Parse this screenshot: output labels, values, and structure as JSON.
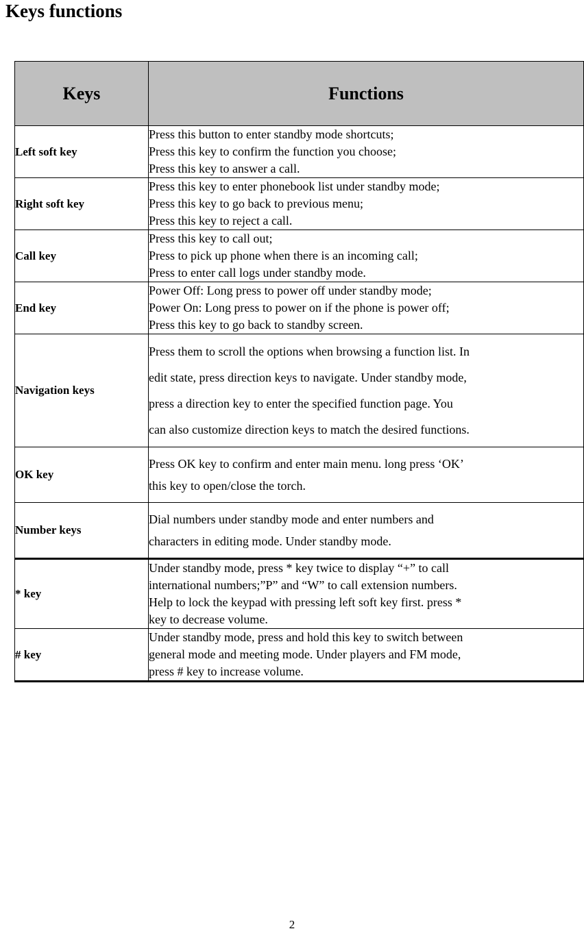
{
  "document": {
    "title": "Keys functions",
    "page_number": "2",
    "header_fill_color": "#BFBFBF",
    "text_color": "#000000",
    "border_color": "#000000"
  },
  "table": {
    "columns": [
      {
        "header": "Keys",
        "align": "center"
      },
      {
        "header": "Functions",
        "align": "center"
      }
    ],
    "rows": [
      {
        "key": "Left soft key",
        "lines": [
          "Press this button to enter standby mode shortcuts;",
          "Press this key to confirm the function you choose;",
          "Press this key to answer a call."
        ]
      },
      {
        "key": "Right soft key",
        "lines": [
          "Press this key to enter phonebook list under standby mode;",
          "Press this key to go back to previous menu;",
          "Press this key to reject a call."
        ]
      },
      {
        "key": "Call key",
        "lines": [
          "Press this key to call out;",
          "Press to pick up phone when there is an incoming call;",
          "Press to enter call logs under standby mode."
        ]
      },
      {
        "key": "End key",
        "lines": [
          "Power Off: Long press to power off under standby mode;",
          "Power On: Long press to power on if the phone is power off;",
          "Press this key to go back to standby screen."
        ]
      },
      {
        "key": "Navigation keys",
        "lines": [
          "Press them to scroll the options when browsing a function list. In",
          "edit state, press direction keys to navigate. Under standby mode,",
          "press a direction key to enter the specified function page. You",
          "can also customize direction keys to match the desired functions."
        ]
      },
      {
        "key": "OK key",
        "lines": [
          "Press OK key to confirm and enter main menu. long press ‘OK’",
          "this key to open/close the torch."
        ]
      },
      {
        "key": "Number keys",
        "lines": [
          "Dial numbers under standby mode and enter numbers and",
          "characters in editing mode. Under standby mode."
        ]
      },
      {
        "key": "* key",
        "lines": [
          "Under standby mode, press * key twice to display “+” to call",
          "international numbers;”P” and “W” to call extension numbers.",
          "Help to lock the keypad with pressing left soft key first. press *",
          "key to decrease volume."
        ]
      },
      {
        "key": "# key",
        "lines": [
          "Under standby mode, press and hold this key to switch between",
          "general mode and meeting mode. Under players and FM mode,",
          "press # key to increase volume."
        ]
      }
    ]
  }
}
